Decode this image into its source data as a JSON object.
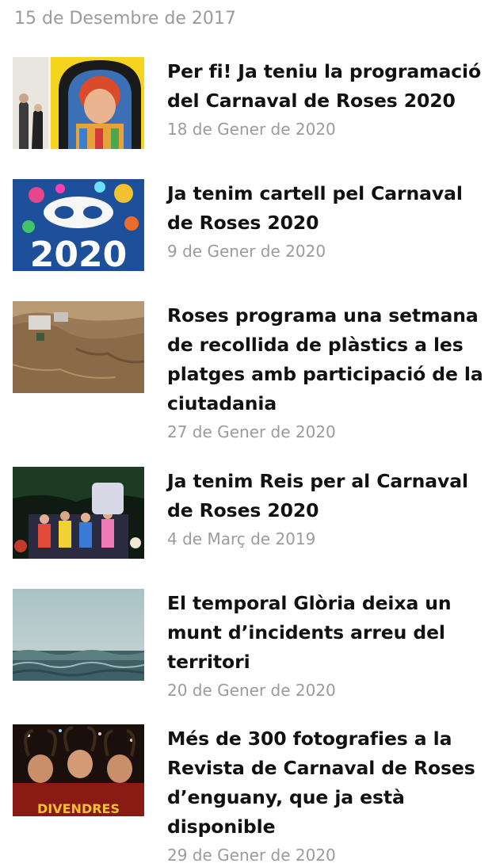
{
  "previous_date": "15 de Desembre de 2017",
  "articles": [
    {
      "title": "Per fi! Ja teniu la programació del Carnaval de Roses 2020",
      "date": "18 de Gener de 2020",
      "thumb_icon": "clown-photo"
    },
    {
      "title": "Ja tenim cartell pel Carnaval de Roses 2020",
      "date": "9 de Gener de 2020",
      "thumb_icon": "poster-2020-photo",
      "thumb_text": "2020"
    },
    {
      "title": "Roses programa una setmana de recollida de plàstics a les platges amb participació de la ciutadania",
      "date": "27 de Gener de 2020",
      "thumb_icon": "aerial-coast-photo"
    },
    {
      "title": "Ja tenim Reis per al Carnaval de Roses 2020",
      "date": "4 de Març de 2019",
      "thumb_icon": "parade-night-photo"
    },
    {
      "title": "El temporal Glòria deixa un munt d’incidents arreu del territori",
      "date": "20 de Gener de 2020",
      "thumb_icon": "stormy-sea-photo"
    },
    {
      "title": "Més de 300 fotografies a la Revista de Carnaval de Roses d’enguany, que ja està disponible",
      "date": "29 de Gener de 2020",
      "thumb_icon": "devils-photo",
      "thumb_text": "DIVENDRES"
    }
  ]
}
